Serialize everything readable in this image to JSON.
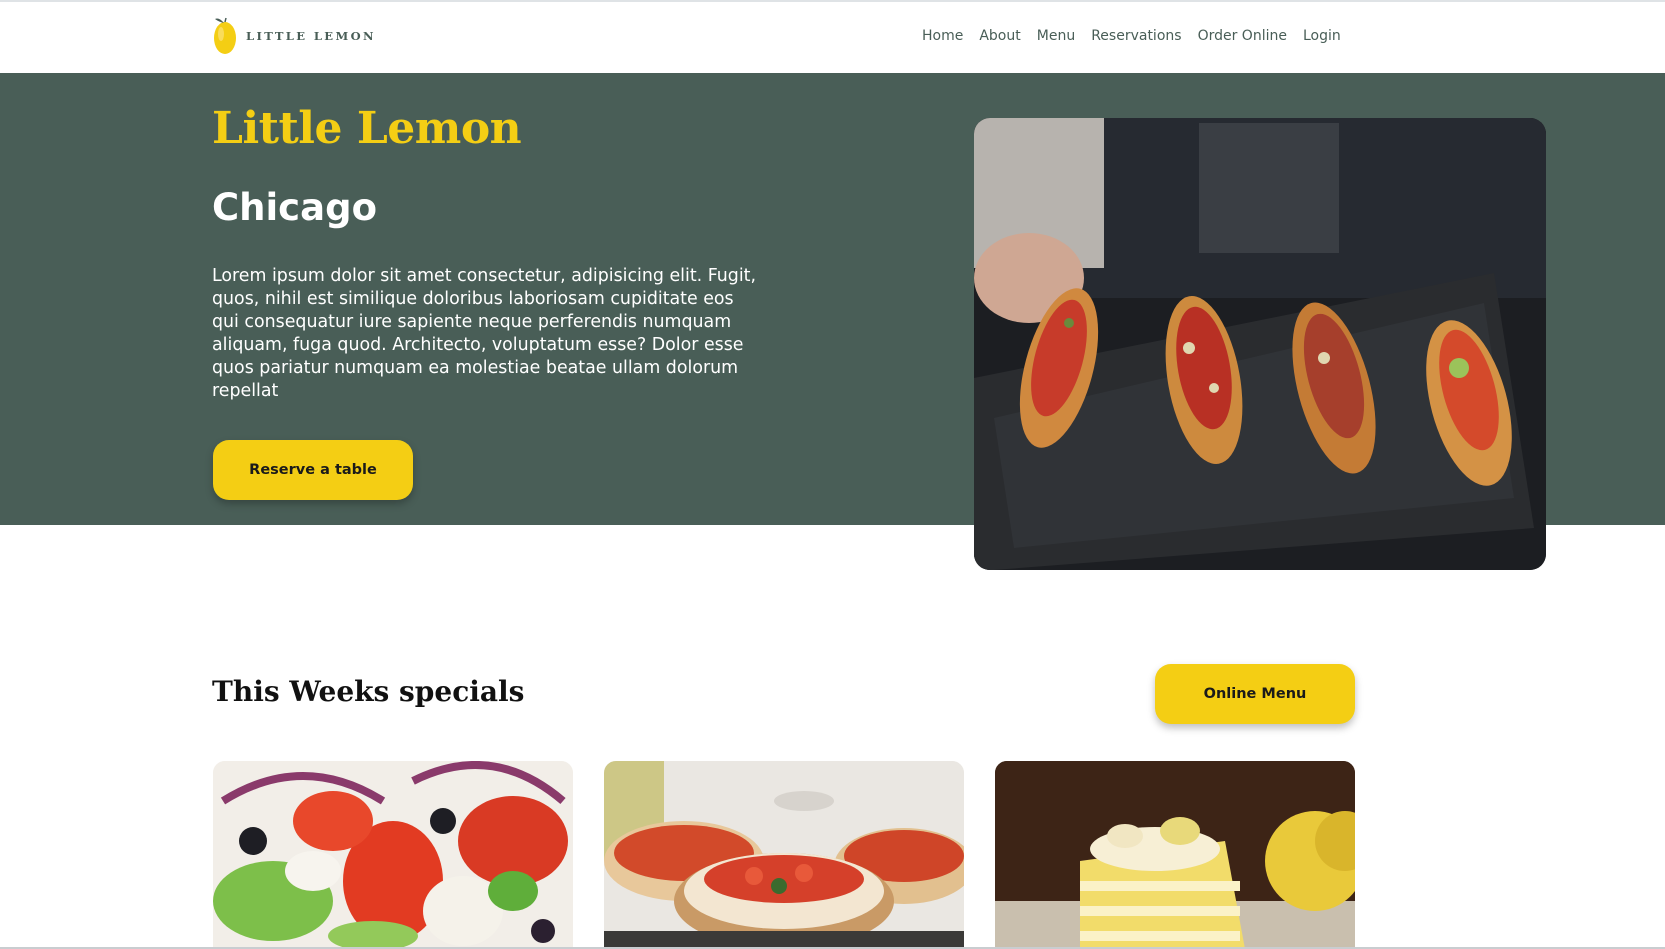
{
  "brand": {
    "name": "LITTLE LEMON",
    "logo_icon": "lemon-icon"
  },
  "nav": {
    "items": [
      {
        "label": "Home"
      },
      {
        "label": "About"
      },
      {
        "label": "Menu"
      },
      {
        "label": "Reservations"
      },
      {
        "label": "Order Online"
      },
      {
        "label": "Login"
      }
    ]
  },
  "hero": {
    "title": "Little Lemon",
    "subtitle": "Chicago",
    "description": "Lorem ipsum dolor sit amet consectetur, adipisicing elit. Fugit, quos, nihil est similique doloribus laboriosam cupiditate eos qui consequatur iure sapiente neque perferendis numquam aliquam, fuga quod. Architecto, voluptatum esse? Dolor esse quos pariatur numquam ea molestiae beatae ullam dolorum repellat",
    "reserve_label": "Reserve a table"
  },
  "specials": {
    "title": "This Weeks specials",
    "menu_button_label": "Online Menu"
  },
  "colors": {
    "primary_green": "#495e57",
    "primary_yellow": "#f4ce14",
    "white": "#ffffff"
  }
}
